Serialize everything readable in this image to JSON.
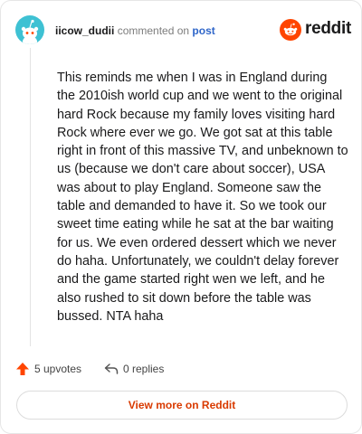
{
  "header": {
    "username": "iicow_dudii",
    "verb": "commented on",
    "post_link": "post"
  },
  "brand": {
    "wordmark": "reddit",
    "accent": "#ff4500"
  },
  "comment": {
    "text": "This reminds me when I was in England during the 2010ish world cup and we went to the original hard Rock because my family loves visiting hard Rock where ever we go. We got sat at this table right in front of this massive TV, and unbeknown to us (because we don't care about soccer), USA was about to play England. Someone saw the table and demanded to have it. So we took our sweet time eating while he sat at the bar waiting for us. We even ordered dessert which we never do haha. Unfortunately, we couldn't delay forever and the game started right wen we left, and he also rushed to sit down before the table was bussed. NTA haha"
  },
  "actions": {
    "upvotes": "5 upvotes",
    "replies": "0 replies"
  },
  "footer": {
    "view_more": "View more on Reddit"
  },
  "icons": {
    "avatar": "snoo-avatar-icon",
    "logo": "reddit-logo-icon",
    "upvote": "upvote-arrow-icon",
    "reply": "reply-arrow-icon"
  }
}
